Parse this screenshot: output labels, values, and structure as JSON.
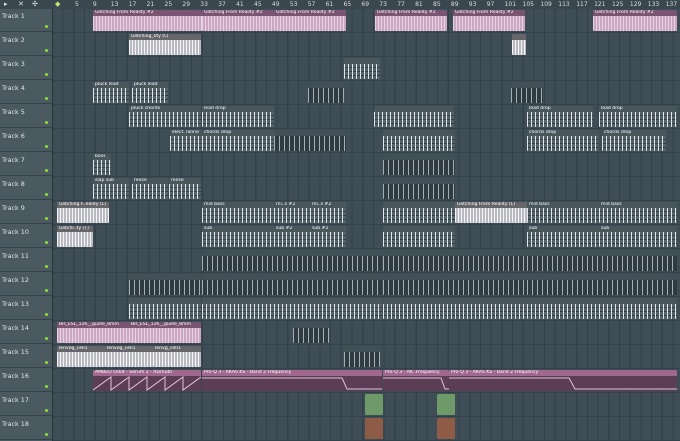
{
  "toolbar": {
    "arrow_icon": "arrow-icon",
    "close_icon": "close-icon",
    "crosshair_icon": "crosshair-icon",
    "marker_icon": "marker-icon"
  },
  "ruler": {
    "bars": [
      "5",
      "9",
      "13",
      "17",
      "21",
      "25",
      "29",
      "33",
      "37",
      "41",
      "45",
      "49",
      "53",
      "57",
      "61",
      "65",
      "69",
      "73",
      "77",
      "81",
      "85",
      "89",
      "93",
      "97",
      "101",
      "105",
      "109",
      "113",
      "117",
      "121",
      "125",
      "129",
      "133",
      "137"
    ]
  },
  "tracks": [
    "Track 1",
    "Track 2",
    "Track 3",
    "Track 4",
    "Track 5",
    "Track 6",
    "Track 7",
    "Track 8",
    "Track 9",
    "Track 10",
    "Track 11",
    "Track 12",
    "Track 13",
    "Track 14",
    "Track 15",
    "Track 16",
    "Track 17",
    "Track 18"
  ],
  "clips": {
    "t1": [
      "Glitching From Reality #2",
      "Glitching From Reality #2",
      "Glitching From Reality #2",
      "Glitching From Reality #2",
      "Glitching From Reality #2",
      "Glitching From Reality #2"
    ],
    "t2": [
      "Glitching_lity (L)"
    ],
    "t4": [
      "pluck lead",
      "pluck lead"
    ],
    "t5": [
      "pluck chords",
      "lead drop",
      "lead drop",
      "lead drop"
    ],
    "t6": [
      "elect. lanne",
      "chords drop",
      "chords drop",
      "chords drop"
    ],
    "t7": [
      "bass"
    ],
    "t8": [
      "slap sub",
      "reese",
      "reese"
    ],
    "t9": [
      "Glitching F..eality (L)",
      "mid bass",
      "mi..s #2",
      "mi..s #2",
      "Glitching From Reality (L)",
      "mid bass",
      "mid bass"
    ],
    "t10": [
      "Glitchi..ty (T)",
      "sub",
      "sub #2",
      "sub #2",
      "sub",
      "sub"
    ],
    "t14": [
      "BH_ESL_126__guide_8mm",
      "BH_ESL_126__guide_8mm"
    ],
    "t15": [
      "lenvog_cell1",
      "lenvog_cell1",
      "lenvg_cell1"
    ],
    "t16": [
      "AMBEO Orbit - Serum 2 - Azimuth",
      "Pro-Q 3 - AKAS KS - Band 2 Frequency",
      "Pro-Q 3 - AK..Frequency",
      "Pro-Q 3 - AKAS KS - Band 2 Frequency"
    ]
  },
  "colors": {
    "header_bg": "#4b5961",
    "grid_bg": "#3f4e56",
    "audio_clip": "#9a6e93",
    "pattern_clip": "#536168",
    "automation_clip": "#a0688f",
    "track_led": "#86d13c"
  }
}
